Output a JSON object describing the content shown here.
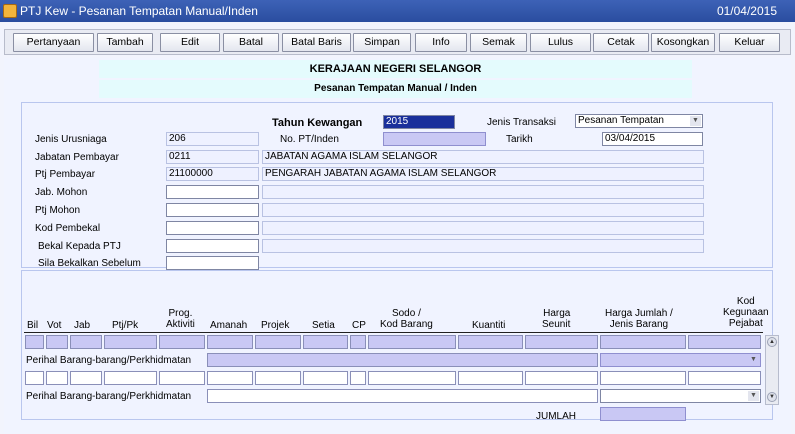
{
  "window": {
    "title": "PTJ Kew - Pesanan Tempatan Manual/Inden",
    "date": "01/04/2015"
  },
  "toolbar": {
    "buttons": [
      "Pertanyaan",
      "Tambah",
      "Edit",
      "Batal",
      "Batal Baris",
      "Simpan",
      "Info",
      "Semak",
      "Lulus",
      "Cetak",
      "Kosongkan",
      "Keluar"
    ]
  },
  "header": {
    "government": "KERAJAAN NEGERI SELANGOR",
    "form_title": "Pesanan Tempatan Manual / Inden"
  },
  "form": {
    "tahun_label": "Tahun Kewangan",
    "tahun_value": "2015",
    "jenis_transaksi_label": "Jenis Transaksi",
    "jenis_transaksi_value": "Pesanan Tempatan",
    "jenis_urusniaga_label": "Jenis Urusniaga",
    "jenis_urusniaga_value": "206",
    "no_pt_label": "No. PT/Inden",
    "no_pt_value": "",
    "tarikh_label": "Tarikh",
    "tarikh_value": "03/04/2015",
    "jabatan_label": "Jabatan Pembayar",
    "jabatan_code": "0211",
    "jabatan_name": "JABATAN AGAMA ISLAM SELANGOR",
    "ptj_label": "Ptj Pembayar",
    "ptj_code": "21100000",
    "ptj_name": "PENGARAH JABATAN AGAMA ISLAM SELANGOR",
    "jab_mohon_label": "Jab. Mohon",
    "ptj_mohon_label": "Ptj Mohon",
    "kod_pembekal_label": "Kod Pembekal",
    "bekal_label": "Bekal Kepada PTJ",
    "sila_label": "Sila Bekalkan Sebelum"
  },
  "grid": {
    "columns": [
      "Bil",
      "Vot",
      "Jab",
      "Ptj/Pk",
      "Prog.\nAktiviti",
      "Amanah",
      "Projek",
      "Setia",
      "CP",
      "Sodo /\nKod Barang",
      "Kuantiti",
      "Harga\nSeunit",
      "Harga Jumlah /\nJenis Barang",
      "Kod\nKegunaan\nPejabat"
    ],
    "perihal_label": "Perihal Barang-barang/Perkhidmatan",
    "jumlah_label": "JUMLAH",
    "jumlah_value": ""
  }
}
